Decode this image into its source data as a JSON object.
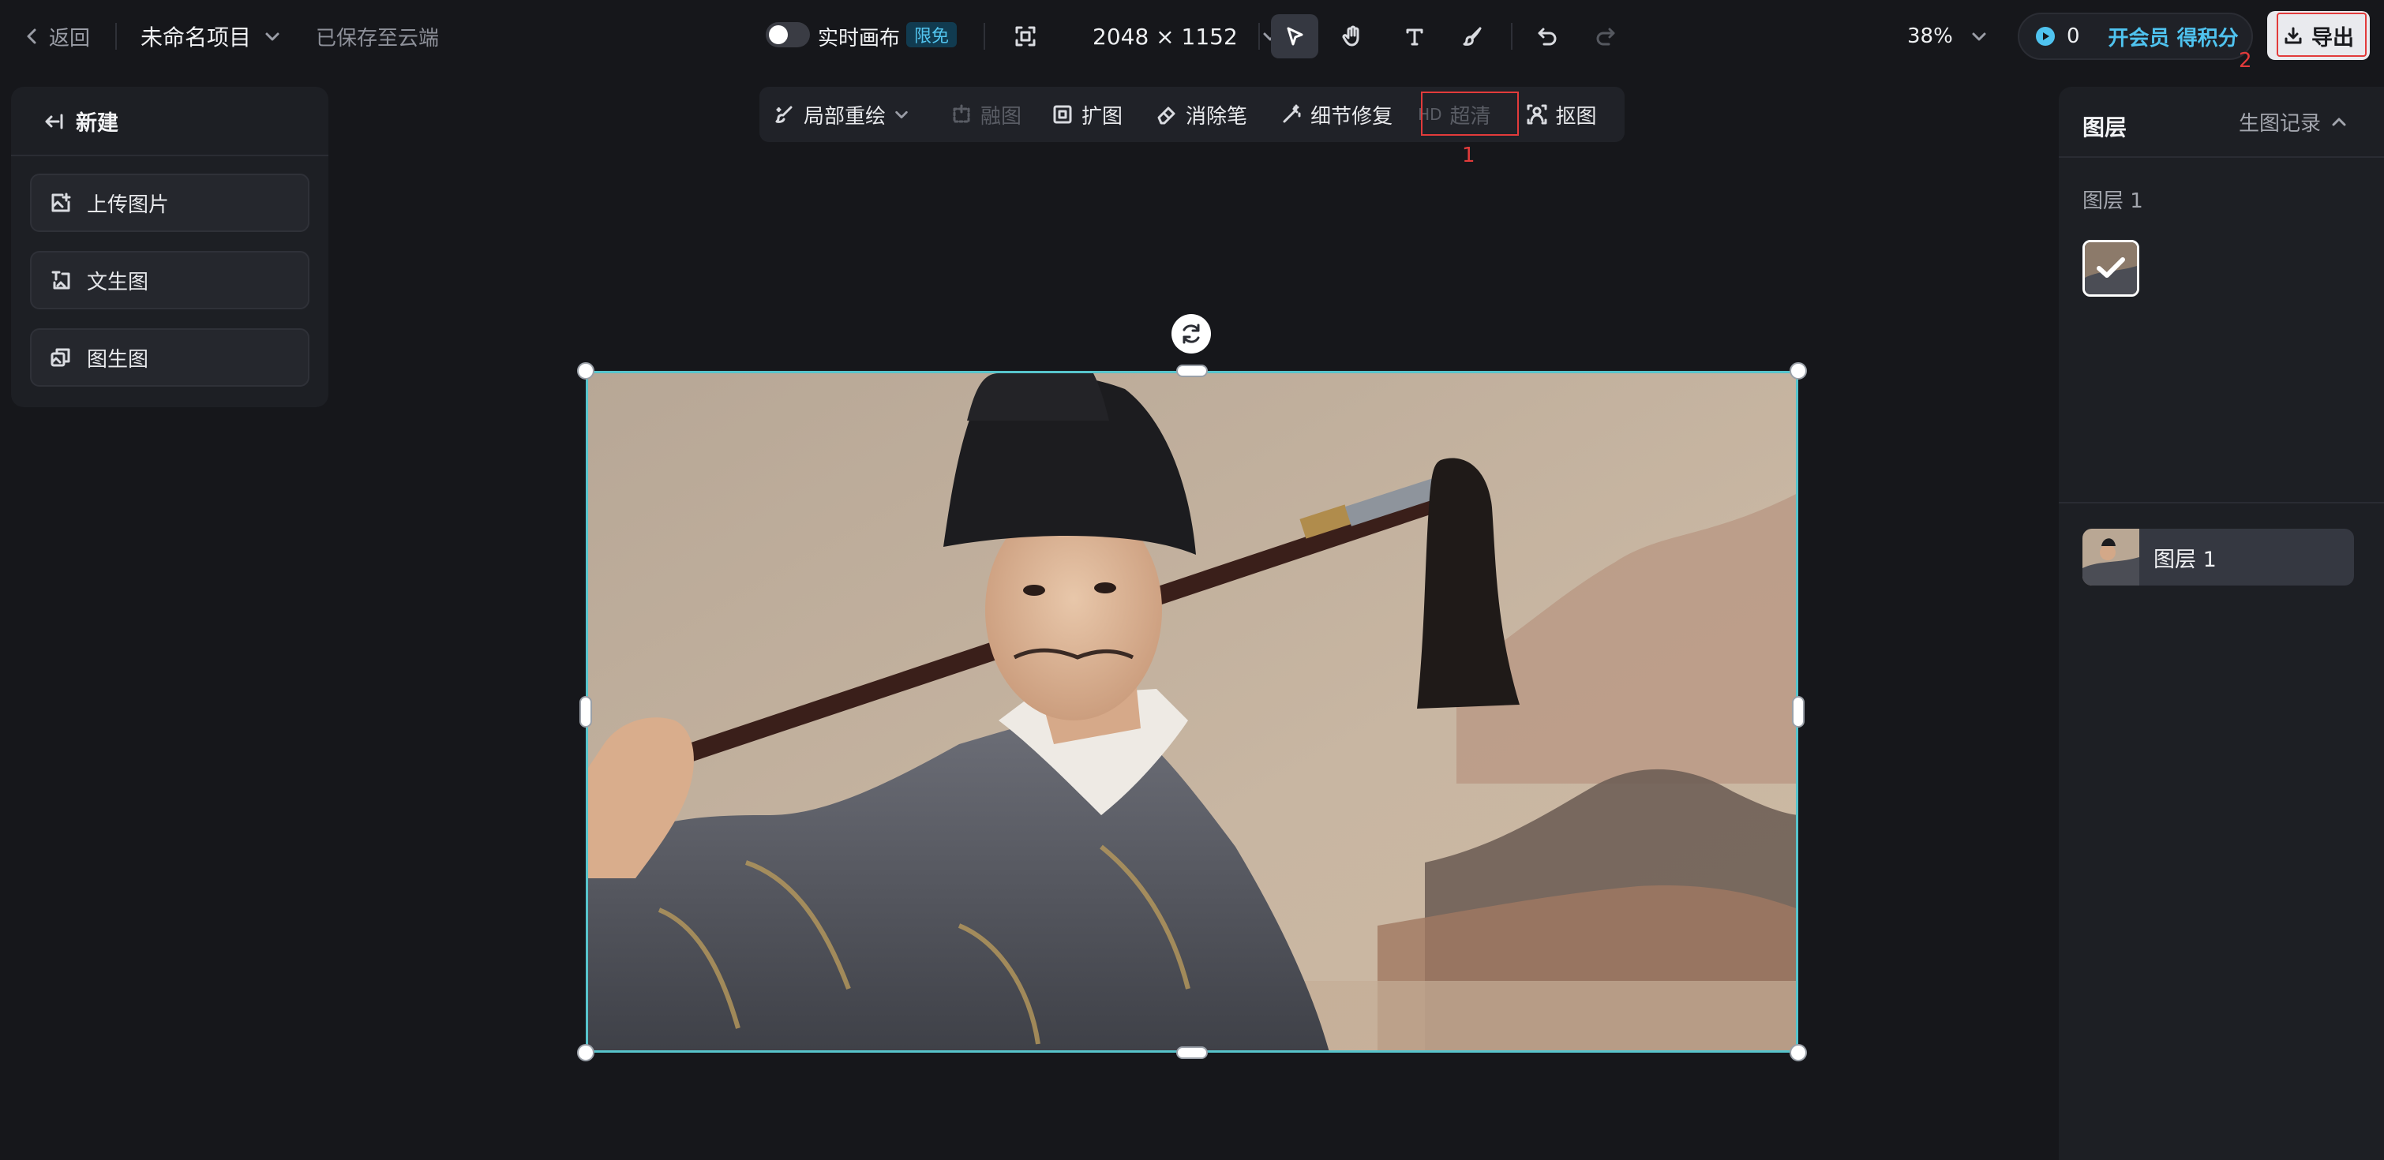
{
  "topbar": {
    "back_label": "返回",
    "project_name": "未命名项目",
    "save_status": "已保存至云端",
    "live_canvas_label": "实时画布",
    "free_badge": "限免",
    "canvas_size": "2048 × 1152",
    "zoom": "38%",
    "credits_count": "0",
    "vip_label": "开会员 得积分",
    "export_label": "导出",
    "annotation_export": "2"
  },
  "subtoolbar": {
    "inpaint": "局部重绘",
    "blend": "融图",
    "expand": "扩图",
    "eraser": "消除笔",
    "detail": "细节修复",
    "hd_prefix": "HD",
    "hd": "超清",
    "cutout": "抠图",
    "annotation_hd": "1"
  },
  "leftpanel": {
    "new_label": "新建",
    "items": [
      "上传图片",
      "文生图",
      "图生图"
    ]
  },
  "rightpanel": {
    "title": "图层",
    "history_label": "生图记录",
    "group_label": "图层 1",
    "layer_name": "图层 1"
  },
  "colors": {
    "background": "#16171b",
    "accent": "#4fc3ef",
    "selection": "#57c4cc",
    "annotation": "#e23b3b"
  }
}
